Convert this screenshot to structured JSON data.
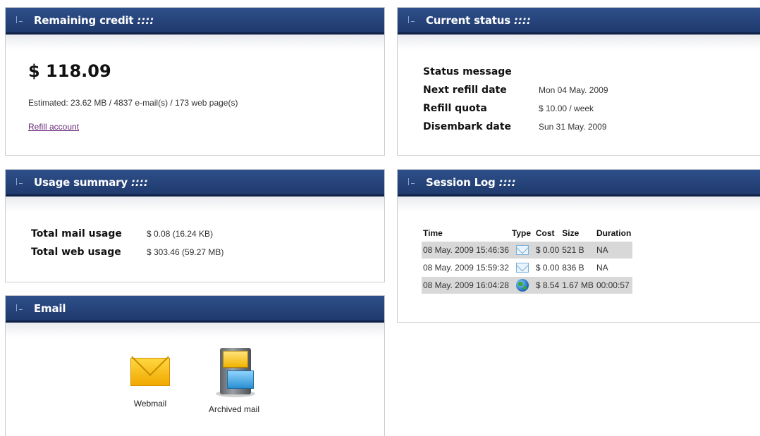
{
  "credit": {
    "title": "Remaining credit",
    "title_suffix": "::::",
    "amount": "$ 118.09",
    "estimated": "Estimated: 23.62 MB / 4837 e-mail(s) / 173 web page(s)",
    "refill_link": "Refill account"
  },
  "status": {
    "title": "Current status",
    "title_suffix": "::::",
    "rows": [
      {
        "label": "Status message",
        "value": ""
      },
      {
        "label": "Next refill date",
        "value": "Mon 04 May. 2009"
      },
      {
        "label": "Refill quota",
        "value": "$ 10.00 / week"
      },
      {
        "label": "Disembark date",
        "value": "Sun 31 May. 2009"
      }
    ]
  },
  "usage": {
    "title": "Usage summary",
    "title_suffix": "::::",
    "rows": [
      {
        "label": "Total mail usage",
        "value": "$ 0.08 (16.24 KB)"
      },
      {
        "label": "Total web usage",
        "value": "$ 303.46 (59.27 MB)"
      }
    ]
  },
  "log": {
    "title": "Session Log",
    "title_suffix": "::::",
    "columns": [
      "Time",
      "Type",
      "Cost",
      "Size",
      "Duration"
    ],
    "rows": [
      {
        "time": "08 May. 2009 15:46:36",
        "type": "mail-icon",
        "cost": "$ 0.00",
        "size": "521 B",
        "duration": "NA"
      },
      {
        "time": "08 May. 2009 15:59:32",
        "type": "mail-icon",
        "cost": "$ 0.00",
        "size": "836 B",
        "duration": "NA"
      },
      {
        "time": "08 May. 2009 16:04:28",
        "type": "globe-icon",
        "cost": "$ 8.54",
        "size": "1.67 MB",
        "duration": "00:00:57"
      }
    ]
  },
  "email": {
    "title": "Email",
    "apps": [
      {
        "label": "Webmail",
        "icon": "envelope-icon"
      },
      {
        "label": "Archived mail",
        "icon": "file-cabinet-icon"
      }
    ]
  },
  "colors": {
    "header_bg": "#1f3a6d",
    "row_shade": "#d8d8d8",
    "link": "#6a2a7a"
  }
}
